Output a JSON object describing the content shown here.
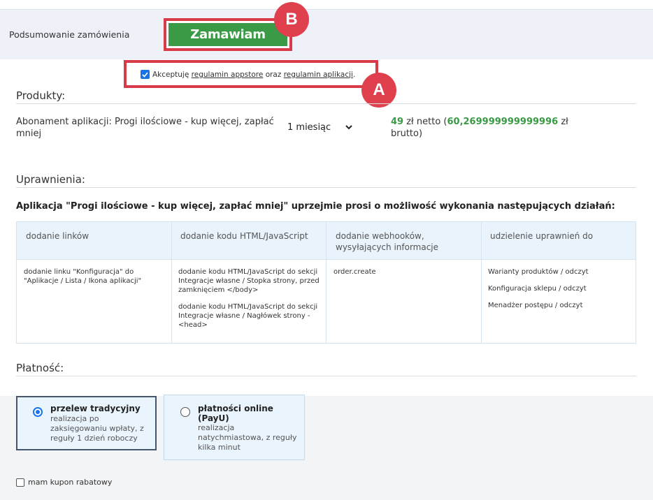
{
  "summary": {
    "label": "Podsumowanie zamówienia",
    "order_button": "Zamawiam",
    "badge_b": "B",
    "badge_a": "A"
  },
  "terms": {
    "prefix": "Akceptuję",
    "link1": "regulamin appstore",
    "mid": "oraz",
    "link2": "regulamin aplikacji",
    "suffix": ".",
    "checked": true
  },
  "products": {
    "title": "Produkty:",
    "name": "Abonament aplikacji: Progi ilościowe - kup więcej, zapłać mniej",
    "period": "1 miesiąc",
    "price_net": "49",
    "price_net_suffix": "zł netto (",
    "price_gross": "60,269999999999996",
    "price_gross_suffix": "zł brutto)"
  },
  "permissions": {
    "title": "Uprawnienia:",
    "heading": "Aplikacja \"Progi ilościowe - kup więcej, zapłać mniej\" uprzejmie prosi o możliwość wykonania następujących działań:",
    "columns": [
      "dodanie linków",
      "dodanie kodu HTML/JavaScript",
      "dodanie webhooków, wysyłających informacje",
      "udzielenie uprawnień do"
    ],
    "col1": [
      "dodanie linku \"Konfiguracja\" do \"Aplikacje / Lista / Ikona aplikacji\""
    ],
    "col2": [
      "dodanie kodu HTML/JavaScript do sekcji Integracje własne / Stopka strony, przed zamknięciem </body>",
      "dodanie kodu HTML/JavaScript do sekcji Integracje własne / Nagłówek strony - <head>"
    ],
    "col3": [
      "order.create"
    ],
    "col4": [
      "Warianty produktów / odczyt",
      "Konfiguracja sklepu / odczyt",
      "Menadżer postępu / odczyt"
    ]
  },
  "payment": {
    "title": "Płatność:",
    "options": [
      {
        "title": "przelew tradycyjny",
        "desc": "realizacja po zaksięgowaniu wpłaty, z reguły 1 dzień roboczy",
        "selected": true
      },
      {
        "title": "płatności online (PayU)",
        "desc": "realizacja natychmiastowa, z reguły kilka minut",
        "selected": false
      }
    ]
  },
  "coupon": {
    "label": "mam kupon rabatowy",
    "checked": false
  },
  "colors": {
    "accent_green": "#3a9a45",
    "highlight_red": "#d93a48",
    "badge_red": "#e0404e",
    "link_blue": "#1a73e8"
  }
}
